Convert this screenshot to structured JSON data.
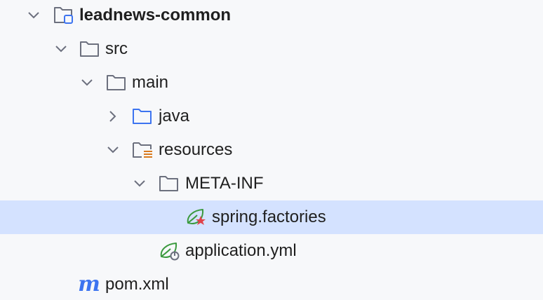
{
  "tree": {
    "items": [
      {
        "label": "leadnews-common",
        "type": "module",
        "state": "expanded"
      },
      {
        "label": "src",
        "type": "folder",
        "state": "expanded"
      },
      {
        "label": "main",
        "type": "folder",
        "state": "expanded"
      },
      {
        "label": "java",
        "type": "source-folder",
        "state": "collapsed"
      },
      {
        "label": "resources",
        "type": "resources-folder",
        "state": "expanded"
      },
      {
        "label": "META-INF",
        "type": "folder",
        "state": "expanded"
      },
      {
        "label": "spring.factories",
        "type": "spring-factories-file",
        "selected": true
      },
      {
        "label": "application.yml",
        "type": "spring-config-file"
      },
      {
        "label": "pom.xml",
        "type": "maven-file",
        "icon_glyph": "m"
      }
    ]
  },
  "colors": {
    "background": "#f7f8fa",
    "selection": "#d4e2ff",
    "folder": "#6c707e",
    "source_folder": "#3d74f0",
    "spring_green": "#3a9a3e",
    "resource_orange": "#d97a1e",
    "factories_red": "#e0424a",
    "maven_blue": "#3d74f0"
  }
}
